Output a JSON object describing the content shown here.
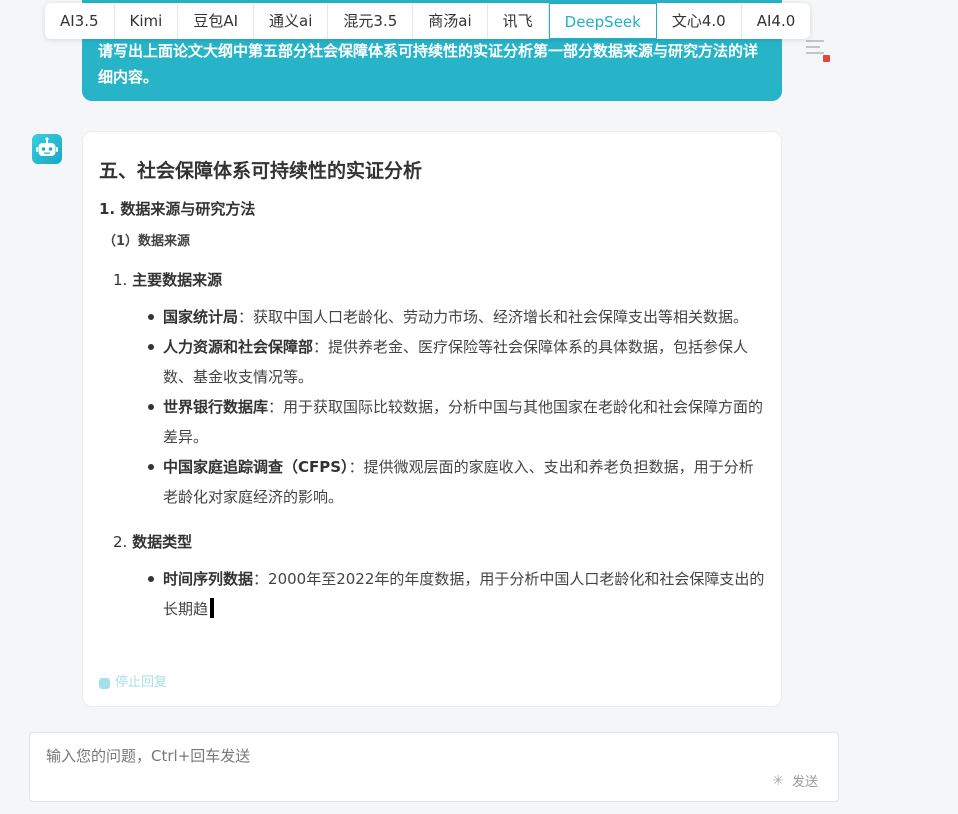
{
  "tabs": [
    {
      "label": "AI3.5"
    },
    {
      "label": "Kimi"
    },
    {
      "label": "豆包AI"
    },
    {
      "label": "通义ai"
    },
    {
      "label": "混元3.5"
    },
    {
      "label": "商汤ai"
    },
    {
      "label": "讯飞"
    },
    {
      "label": "DeepSeek"
    },
    {
      "label": "文心4.0"
    },
    {
      "label": "AI4.0"
    }
  ],
  "active_tab": "DeepSeek",
  "user_message": {
    "text": "请写出上面论文大纲中第五部分社会保障体系可持续性的实证分析第一部分数据来源与研究方法的详细内容。"
  },
  "answer": {
    "title": "五、社会保障体系可持续性的实证分析",
    "subtitle": "1. 数据来源与研究方法",
    "subsection": "（1）数据来源",
    "sections": [
      {
        "num": "1.",
        "label": "主要数据来源",
        "items": [
          {
            "term": "国家统计局",
            "sep": "：",
            "text": "获取中国人口老龄化、劳动力市场、经济增长和社会保障支出等相关数据。"
          },
          {
            "term": "人力资源和社会保障部",
            "sep": "：",
            "text": "提供养老金、医疗保险等社会保障体系的具体数据，包括参保人数、基金收支情况等。"
          },
          {
            "term": "世界银行数据库",
            "sep": "：",
            "text": "用于获取国际比较数据，分析中国与其他国家在老龄化和社会保障方面的差异。"
          },
          {
            "term": "中国家庭追踪调查（CFPS）",
            "sep": "：",
            "text": "提供微观层面的家庭收入、支出和养老负担数据，用于分析老龄化对家庭经济的影响。"
          }
        ]
      },
      {
        "num": "2.",
        "label": "数据类型",
        "items": [
          {
            "term": "时间序列数据",
            "sep": "：",
            "text": "2000年至2022年的年度数据，用于分析中国人口老龄化和社会保障支出的长期趋"
          }
        ]
      }
    ],
    "stop_label": "停止回复"
  },
  "input": {
    "placeholder": "输入您的问题，Ctrl+回车发送",
    "value": "",
    "send_label": "发送"
  },
  "colors": {
    "accent": "#27b4c9",
    "stop": "#a6e0ea"
  }
}
